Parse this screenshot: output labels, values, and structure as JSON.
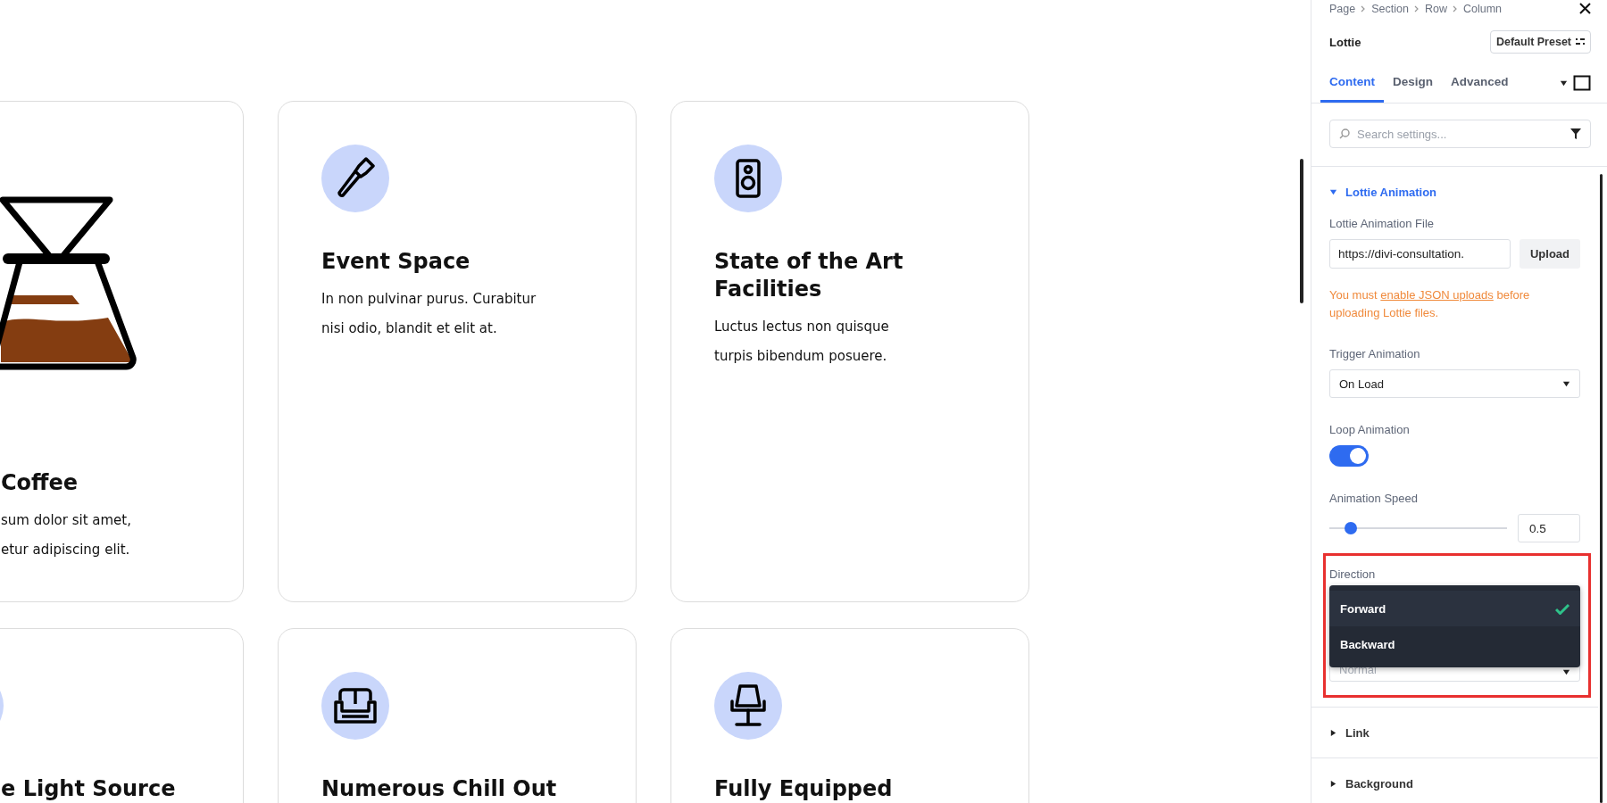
{
  "canvas": {
    "rows": [
      {
        "cards": [
          {
            "kind": "lottie",
            "title": "Coffee",
            "lines": [
              "sum dolor sit amet,",
              "etur adipiscing elit."
            ]
          },
          {
            "kind": "icon",
            "title": "Event Space",
            "lines": [
              "In non pulvinar purus. Curabitur",
              "nisi odio, blandit et elit at."
            ]
          },
          {
            "kind": "icon",
            "title": "State of the Art Facilities",
            "lines": [
              "Luctus lectus non quisque",
              "turpis bibendum posuere."
            ]
          }
        ]
      },
      {
        "cards": [
          {
            "kind": "icon",
            "title": "e Light Source"
          },
          {
            "kind": "icon",
            "title": "Numerous Chill Out"
          },
          {
            "kind": "icon",
            "title": "Fully Equipped"
          }
        ]
      }
    ]
  },
  "panel": {
    "breadcrumb": [
      "Page",
      "Section",
      "Row",
      "Column"
    ],
    "module": "Lottie",
    "preset": "Default Preset",
    "tabs": [
      {
        "label": "Content",
        "selected": true
      },
      {
        "label": "Design",
        "selected": false
      },
      {
        "label": "Advanced",
        "selected": false
      }
    ],
    "search": {
      "placeholder": "Search settings..."
    },
    "open_section": {
      "title": "Lottie Animation",
      "expanded": true,
      "fields": [
        {
          "kind": "file",
          "label": "Lottie Animation File",
          "value": "https://divi-consultation.",
          "button": "Upload"
        },
        {
          "kind": "note",
          "before": "You must ",
          "link": "enable JSON uploads",
          "after": " before uploading Lottie files."
        },
        {
          "kind": "select",
          "label": "Trigger Animation",
          "value": "On Load"
        },
        {
          "kind": "toggle",
          "label": "Loop Animation",
          "on": true
        },
        {
          "kind": "slider",
          "label": "Animation Speed",
          "level": 0.12,
          "value": "0.5"
        },
        {
          "kind": "dropdown",
          "label": "Direction",
          "value": "Normal",
          "options": [
            {
              "label": "Forward",
              "selected": true
            },
            {
              "label": "Backward",
              "selected": false
            }
          ]
        }
      ]
    },
    "collapsed_sections": [
      {
        "title": "Link",
        "expanded": false
      },
      {
        "title": "Background",
        "expanded": false
      }
    ]
  }
}
